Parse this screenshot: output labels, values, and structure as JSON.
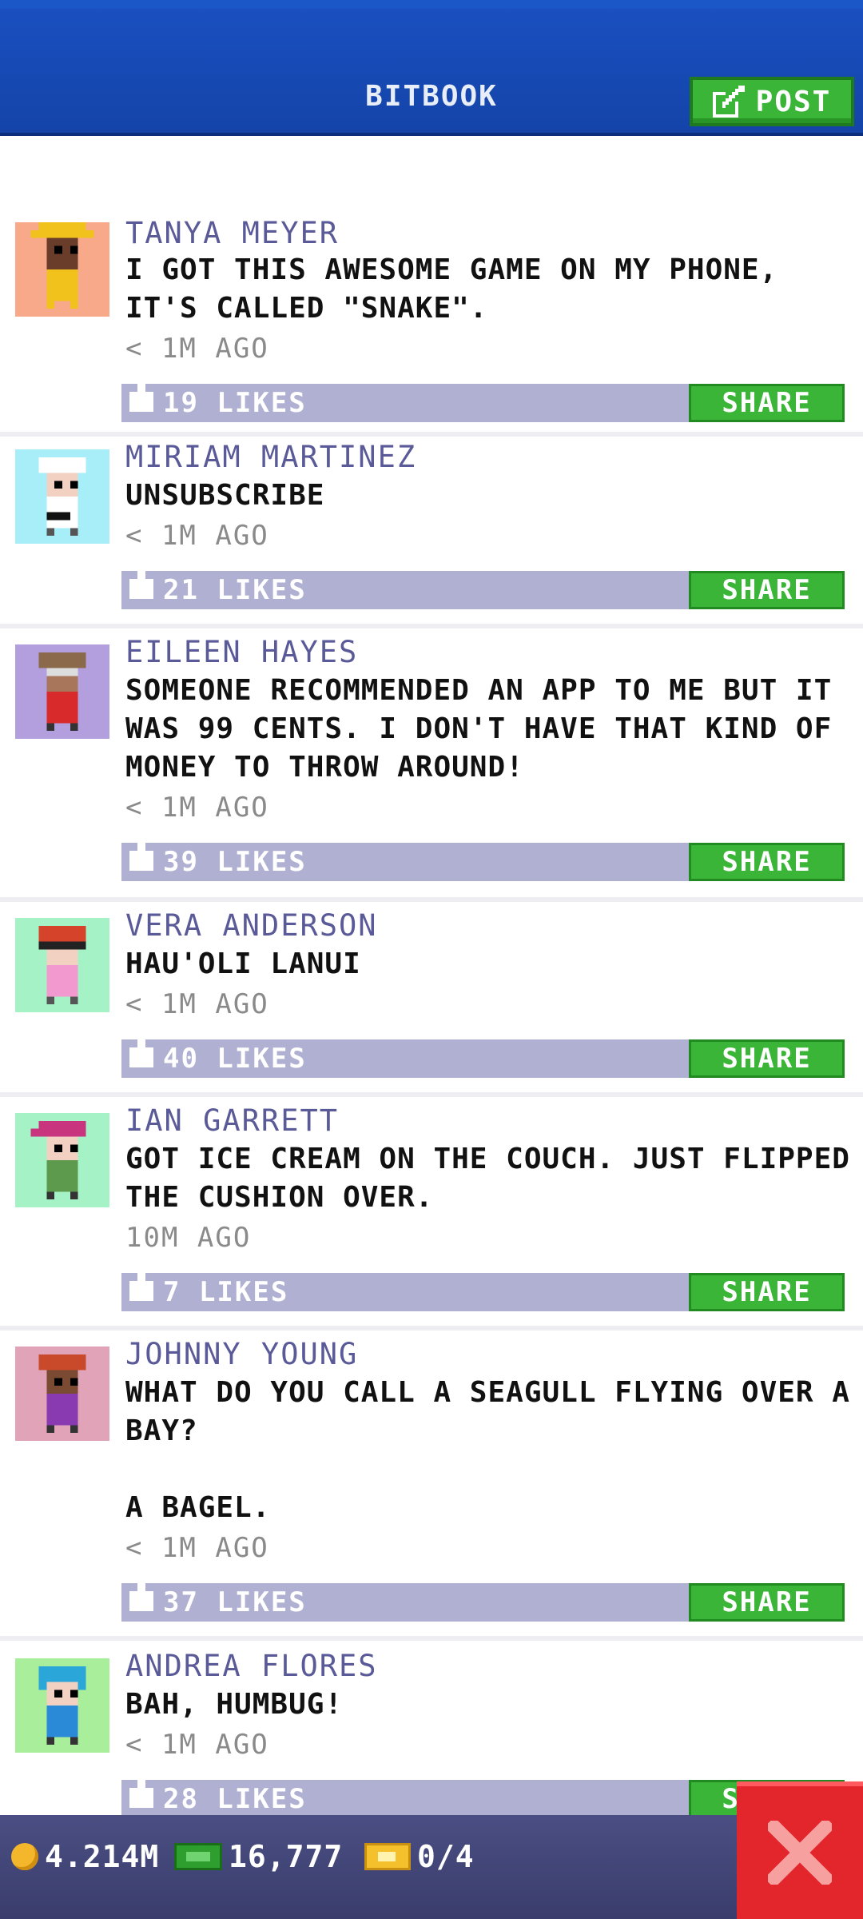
{
  "header": {
    "title": "BITBOOK",
    "post_label": "POST"
  },
  "posts": [
    {
      "name": "TANYA MEYER",
      "text": "I GOT THIS AWESOME GAME ON MY PHONE, IT'S CALLED \"SNAKE\".",
      "time": "< 1M AGO",
      "likes": "19 LIKES",
      "share": "SHARE",
      "avatar_bg": "#f7a98a",
      "avatar_icon": "character-yellow-hat-icon"
    },
    {
      "name": "MIRIAM MARTINEZ",
      "text": "UNSUBSCRIBE",
      "time": "< 1M AGO",
      "likes": "21 LIKES",
      "share": "SHARE",
      "avatar_bg": "#a7eef8",
      "avatar_icon": "character-chef-icon"
    },
    {
      "name": "EILEEN HAYES",
      "text": "SOMEONE RECOMMENDED AN APP TO ME BUT IT WAS 99 CENTS. I DON'T HAVE THAT KIND OF MONEY TO THROW AROUND!",
      "time": "< 1M AGO",
      "likes": "39 LIKES",
      "share": "SHARE",
      "avatar_bg": "#b39fde",
      "avatar_icon": "character-glasses-grandma-icon"
    },
    {
      "name": "VERA ANDERSON",
      "text": "HAU'OLI LANUI",
      "time": "< 1M AGO",
      "likes": "40 LIKES",
      "share": "SHARE",
      "avatar_bg": "#a5f2c6",
      "avatar_icon": "character-redhead-glasses-icon"
    },
    {
      "name": "IAN GARRETT",
      "text": "GOT ICE CREAM ON THE COUCH. JUST FLIPPED THE CUSHION OVER.",
      "time": "10M AGO",
      "likes": "7 LIKES",
      "share": "SHARE",
      "avatar_bg": "#a5f2c6",
      "avatar_icon": "character-pink-cap-icon"
    },
    {
      "name": "JOHNNY YOUNG",
      "text": "WHAT DO YOU CALL A SEAGULL FLYING OVER A BAY?\n\nA BAGEL.",
      "time": "< 1M AGO",
      "likes": "37 LIKES",
      "share": "SHARE",
      "avatar_bg": "#e0a3b8",
      "avatar_icon": "character-purple-suit-icon"
    },
    {
      "name": "ANDREA FLORES",
      "text": "BAH, HUMBUG!",
      "time": "< 1M AGO",
      "likes": "28 LIKES",
      "share": "SHARE",
      "avatar_bg": "#a9ee9a",
      "avatar_icon": "character-blue-hood-icon"
    }
  ],
  "footer": {
    "coins": "4.214M",
    "bux": "16,777",
    "tickets": "0/4"
  },
  "colors": {
    "header_blue": "#1444a8",
    "accent_green": "#3bb538",
    "likes_bar": "#b0b0d2",
    "name_purple": "#5a5a98",
    "close_red": "#e2262c"
  }
}
